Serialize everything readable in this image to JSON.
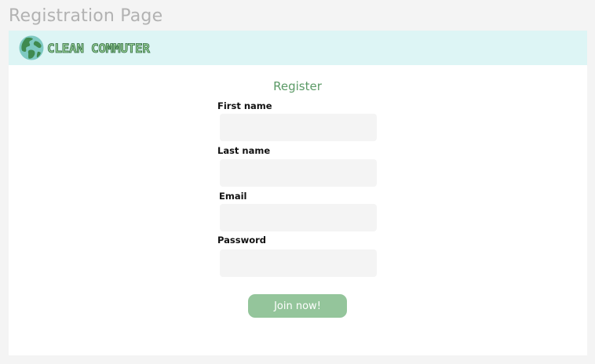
{
  "page": {
    "heading": "Registration Page"
  },
  "header": {
    "logo_icon": "globe-icon",
    "brand_name": "CLEAN COMMUTER"
  },
  "form": {
    "title": "Register",
    "fields": [
      {
        "label": "First name",
        "value": "",
        "placeholder": ""
      },
      {
        "label": "Last name",
        "value": "",
        "placeholder": ""
      },
      {
        "label": "Email",
        "value": "",
        "placeholder": ""
      },
      {
        "label": "Password",
        "value": "",
        "placeholder": ""
      }
    ],
    "submit_label": "Join now!"
  },
  "colors": {
    "header_background": "#ddf5f5",
    "accent_green": "#5b9a66",
    "button_green": "#94c59b",
    "input_background": "#f4f4f4",
    "globe_ocean": "#7ec9c2",
    "globe_land": "#3f8a4f"
  }
}
